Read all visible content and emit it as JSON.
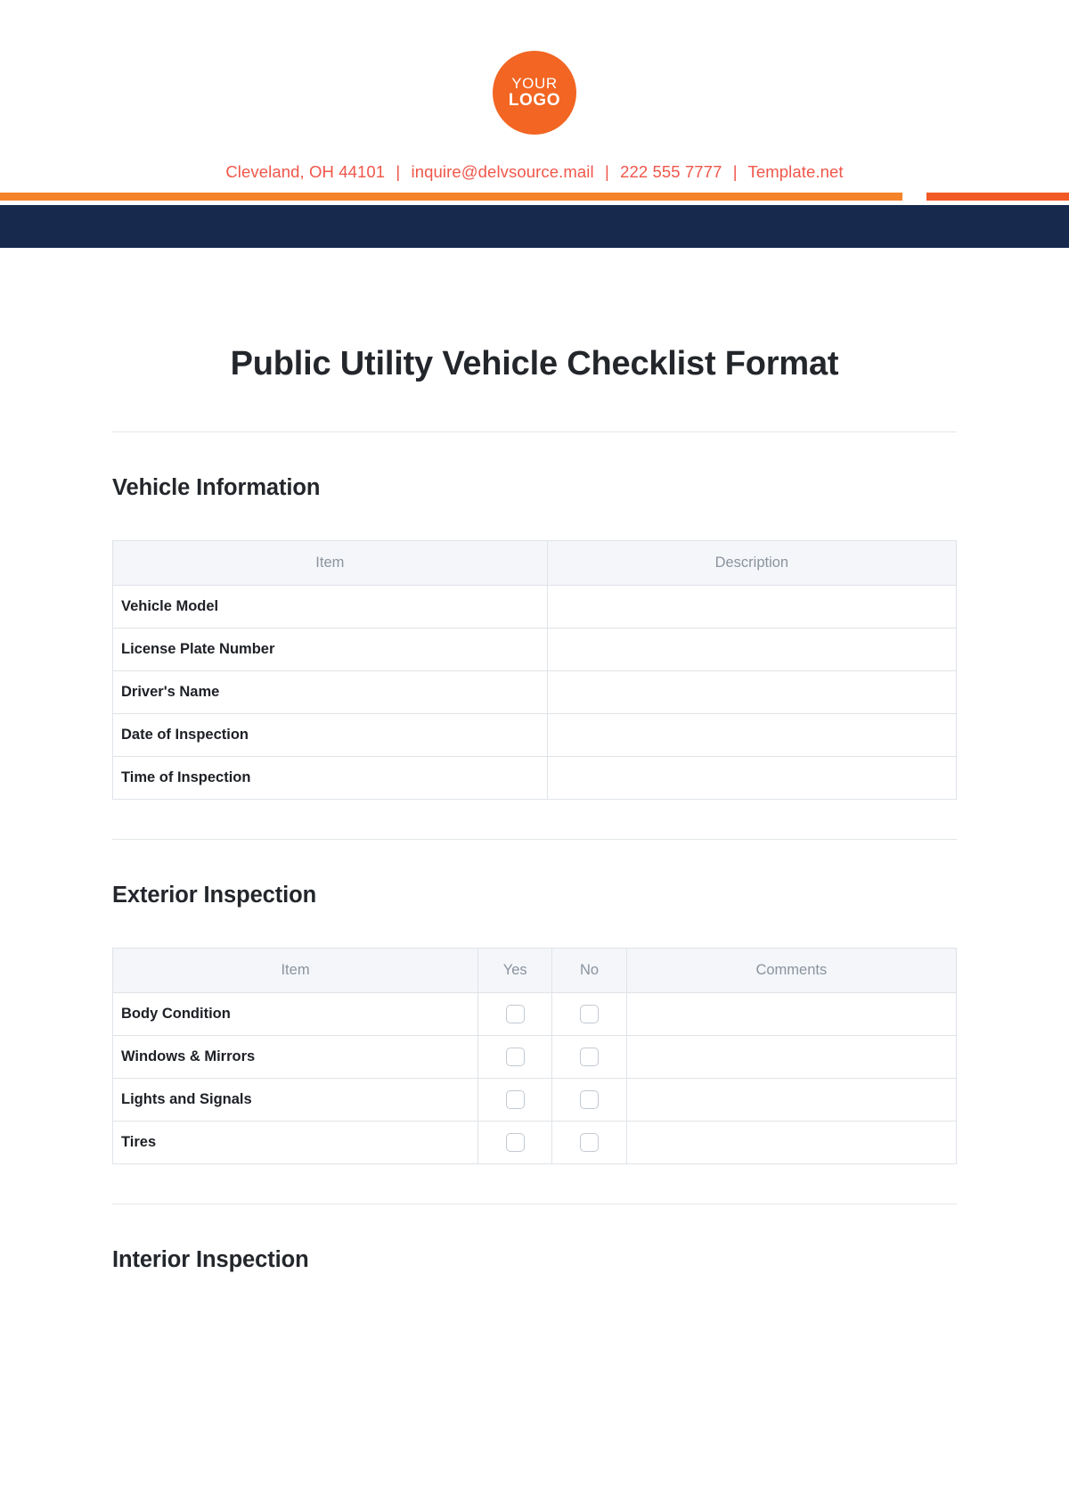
{
  "letterhead": {
    "logo": {
      "line1": "YOUR",
      "line2": "LOGO",
      "color": "#F26522"
    },
    "contact": {
      "address": "Cleveland, OH 44101",
      "email": "inquire@delvsource.mail",
      "phone": "222 555 7777",
      "website": "Template.net",
      "separator": "|",
      "color": "#F0564A"
    },
    "rules": {
      "left_color": "#F5832A",
      "right_color": "#F15A24",
      "band_color": "#172A4E"
    }
  },
  "document": {
    "title": "Public Utility Vehicle Checklist Format",
    "sections": [
      {
        "heading": "Vehicle Information",
        "type": "info",
        "columns": [
          "Item",
          "Description"
        ],
        "rows": [
          {
            "item": "Vehicle Model",
            "description": ""
          },
          {
            "item": "License Plate Number",
            "description": ""
          },
          {
            "item": "Driver's Name",
            "description": ""
          },
          {
            "item": "Date of Inspection",
            "description": ""
          },
          {
            "item": "Time of Inspection",
            "description": ""
          }
        ]
      },
      {
        "heading": "Exterior Inspection",
        "type": "checklist",
        "columns": [
          "Item",
          "Yes",
          "No",
          "Comments"
        ],
        "rows": [
          {
            "item": "Body Condition",
            "yes": false,
            "no": false,
            "comments": ""
          },
          {
            "item": "Windows & Mirrors",
            "yes": false,
            "no": false,
            "comments": ""
          },
          {
            "item": "Lights and Signals",
            "yes": false,
            "no": false,
            "comments": ""
          },
          {
            "item": "Tires",
            "yes": false,
            "no": false,
            "comments": ""
          }
        ]
      },
      {
        "heading": "Interior Inspection",
        "type": "checklist",
        "columns": [],
        "rows": []
      }
    ]
  }
}
